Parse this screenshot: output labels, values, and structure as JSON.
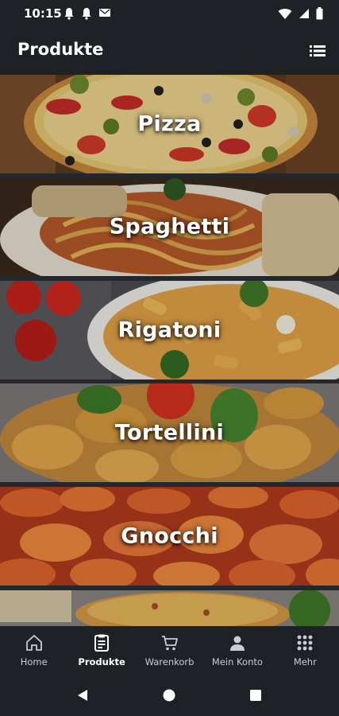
{
  "status_bar": {
    "time": "10:15",
    "left_icons": [
      "notification-bell-icon",
      "notification-bell-icon",
      "mail-icon"
    ],
    "right_icons": [
      "wifi-icon",
      "cellular-signal-icon",
      "battery-icon"
    ]
  },
  "app_bar": {
    "title": "Produkte",
    "action_icon": "list-view-icon"
  },
  "products": [
    {
      "label": "Pizza"
    },
    {
      "label": "Spaghetti"
    },
    {
      "label": "Rigatoni"
    },
    {
      "label": "Tortellini"
    },
    {
      "label": "Gnocchi"
    },
    {
      "label": ""
    }
  ],
  "bottom_nav": {
    "items": [
      {
        "label": "Home",
        "icon": "home-icon",
        "active": false
      },
      {
        "label": "Produkte",
        "icon": "menu-card-icon",
        "active": true
      },
      {
        "label": "Warenkorb",
        "icon": "shopping-cart-icon",
        "active": false
      },
      {
        "label": "Mein Konto",
        "icon": "account-icon",
        "active": false
      },
      {
        "label": "Mehr",
        "icon": "more-grid-icon",
        "active": false
      }
    ]
  },
  "system_nav": {
    "icons": [
      "back-icon",
      "home-circle-icon",
      "recents-icon"
    ]
  },
  "colors": {
    "bar_background": "#1e2227",
    "nav_inactive": "#c9ced4",
    "nav_active": "#ffffff"
  }
}
